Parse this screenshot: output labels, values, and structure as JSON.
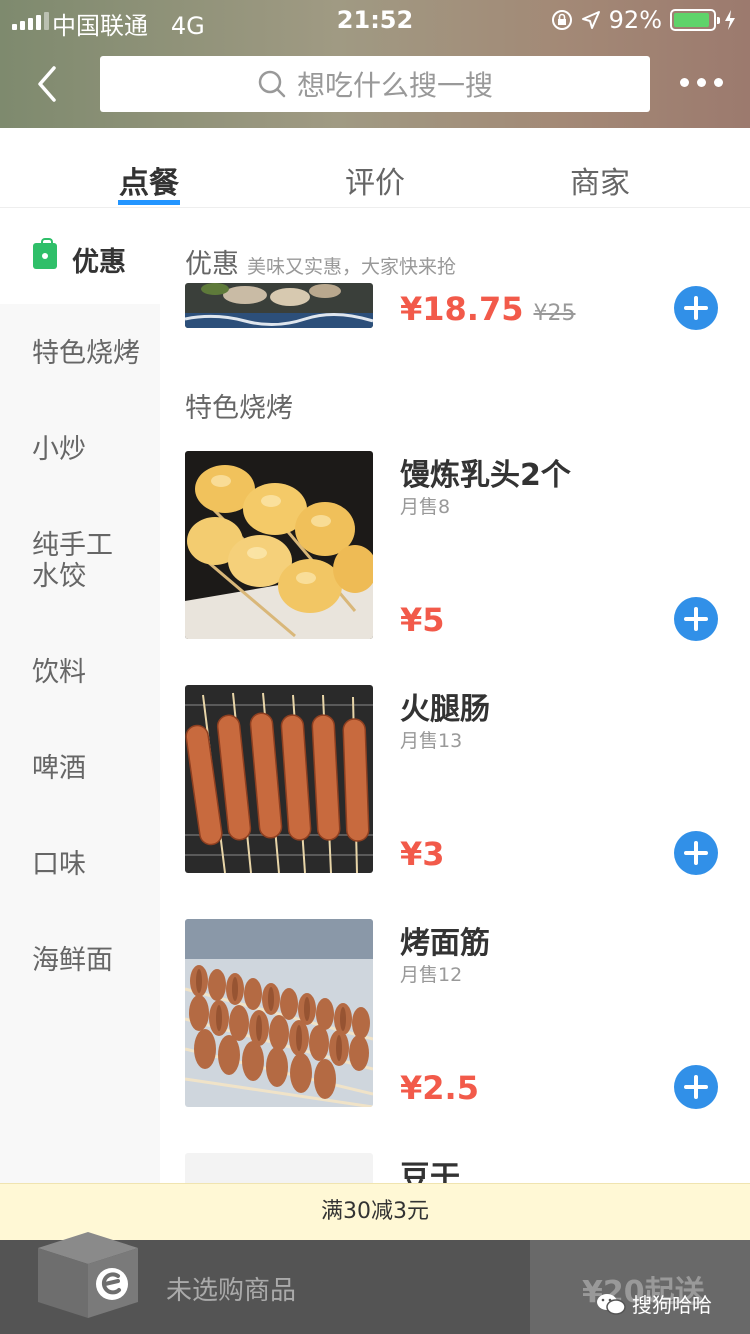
{
  "status": {
    "carrier": "中国联通",
    "network": "4G",
    "time": "21:52",
    "battery": "92%",
    "battery_level": 0.92
  },
  "nav": {
    "search_placeholder": "想吃什么搜一搜"
  },
  "tabs": [
    {
      "label": "点餐"
    },
    {
      "label": "评价"
    },
    {
      "label": "商家"
    }
  ],
  "sidebar": {
    "items": [
      {
        "label": "优惠"
      },
      {
        "label": "特色烧烤"
      },
      {
        "label": "小炒"
      },
      {
        "label": "纯手工"
      },
      {
        "label": "水饺"
      },
      {
        "label": "饮料"
      },
      {
        "label": "啤酒"
      },
      {
        "label": "口味"
      },
      {
        "label": "海鲜面"
      }
    ]
  },
  "sections": {
    "promo": {
      "title": "优惠",
      "subtitle": "美味又实惠，大家快来抢",
      "price": "¥18.75",
      "original_price": "¥25"
    },
    "bbq": {
      "title": "特色烧烤"
    }
  },
  "items": [
    {
      "name": "馒炼乳头2个",
      "sold": "月售8",
      "price": "¥5"
    },
    {
      "name": "火腿肠",
      "sold": "月售13",
      "price": "¥3"
    },
    {
      "name": "烤面筋",
      "sold": "月售12",
      "price": "¥2.5"
    },
    {
      "name": "豆干"
    }
  ],
  "promo_bar": {
    "text": "满30减3元"
  },
  "cart": {
    "empty_text": "未选购商品",
    "min_order": "¥20起送"
  },
  "watermark": {
    "text": "搜狗哈哈"
  },
  "colors": {
    "accent": "#2395ff",
    "price": "#f25a4a",
    "add_button": "#3190e8",
    "promo_bg": "#fff8d5"
  }
}
